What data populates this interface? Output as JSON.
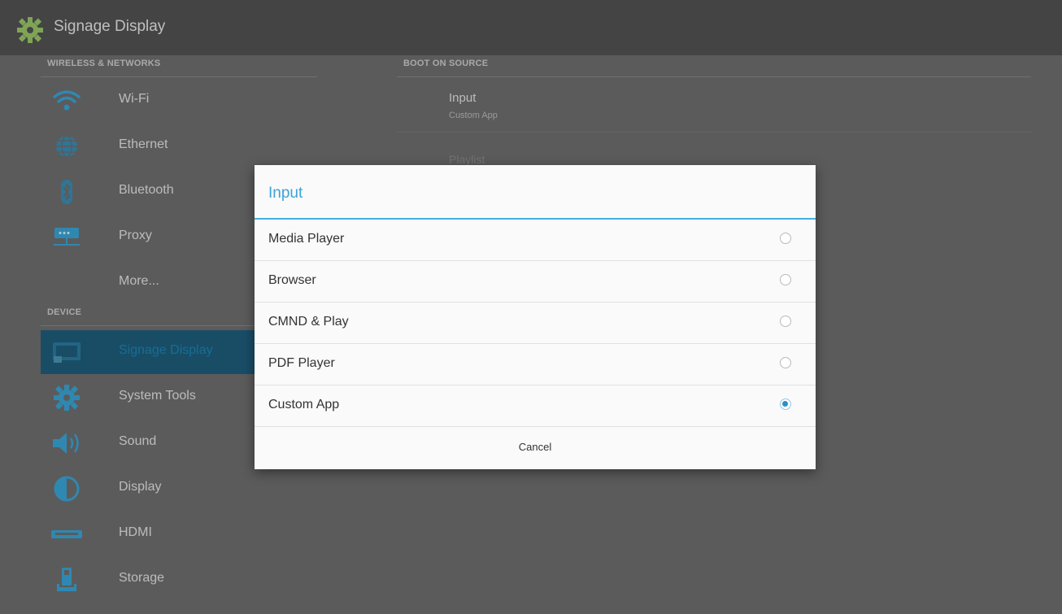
{
  "actionbar": {
    "title": "Signage Display",
    "icon": "gear-icon"
  },
  "left": {
    "section_wireless": "WIRELESS & NETWORKS",
    "section_device": "DEVICE",
    "items": [
      {
        "label": "Wi-Fi",
        "icon": "wifi-icon"
      },
      {
        "label": "Ethernet",
        "icon": "globe-icon"
      },
      {
        "label": "Bluetooth",
        "icon": "bluetooth-icon"
      },
      {
        "label": "Proxy",
        "icon": "proxy-icon"
      },
      {
        "label": "More...",
        "icon": ""
      },
      {
        "label": "Signage Display",
        "icon": "display-panel-icon",
        "selected": true
      },
      {
        "label": "System Tools",
        "icon": "gear-icon"
      },
      {
        "label": "Sound",
        "icon": "speaker-icon"
      },
      {
        "label": "Display",
        "icon": "contrast-icon"
      },
      {
        "label": "HDMI",
        "icon": "hdmi-icon"
      },
      {
        "label": "Storage",
        "icon": "storage-icon"
      }
    ]
  },
  "right": {
    "section": "BOOT ON SOURCE",
    "pref_title": "Input",
    "pref_summary": "Custom App",
    "pref_faded": "Playlist"
  },
  "dialog": {
    "title": "Input",
    "options": [
      {
        "label": "Media Player",
        "checked": false
      },
      {
        "label": "Browser",
        "checked": false
      },
      {
        "label": "CMND & Play",
        "checked": false
      },
      {
        "label": "PDF Player",
        "checked": false
      },
      {
        "label": "Custom App",
        "checked": true
      }
    ],
    "cancel": "Cancel"
  },
  "colors": {
    "accent": "#3ba4d6",
    "selected_bg": "#1f5f7d",
    "background": "#6f6f6f"
  }
}
